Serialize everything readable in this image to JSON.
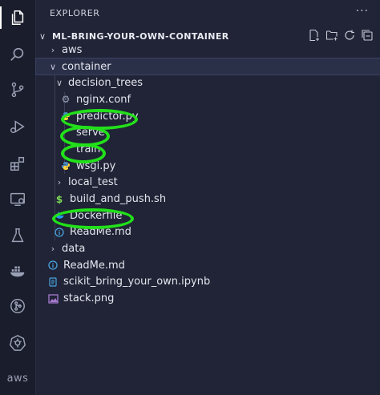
{
  "sidebar": {
    "header": "EXPLORER",
    "more": "···",
    "root_title": "ML-BRING-YOUR-OWN-CONTAINER"
  },
  "tree": [
    {
      "label": "aws",
      "kind": "folder",
      "expanded": false,
      "depth": 0
    },
    {
      "label": "container",
      "kind": "folder",
      "expanded": true,
      "depth": 0,
      "selected": true
    },
    {
      "label": "decision_trees",
      "kind": "folder",
      "expanded": true,
      "depth": 1
    },
    {
      "label": "nginx.conf",
      "kind": "gear",
      "depth": 2
    },
    {
      "label": "predictor.py",
      "kind": "python",
      "depth": 2,
      "highlighted": true
    },
    {
      "label": "serve",
      "kind": "none",
      "depth": 2,
      "highlighted": true
    },
    {
      "label": "train",
      "kind": "none",
      "depth": 2,
      "highlighted": true
    },
    {
      "label": "wsgi.py",
      "kind": "python",
      "depth": 2
    },
    {
      "label": "local_test",
      "kind": "folder",
      "expanded": false,
      "depth": 1
    },
    {
      "label": "build_and_push.sh",
      "kind": "shell",
      "depth": 1
    },
    {
      "label": "Dockerfile",
      "kind": "docker",
      "depth": 1,
      "highlighted": true
    },
    {
      "label": "ReadMe.md",
      "kind": "info",
      "depth": 1
    },
    {
      "label": "data",
      "kind": "folder",
      "expanded": false,
      "depth": 0
    },
    {
      "label": "ReadMe.md",
      "kind": "info",
      "depth": 0
    },
    {
      "label": "scikit_bring_your_own.ipynb",
      "kind": "notebook",
      "depth": 0
    },
    {
      "label": "stack.png",
      "kind": "image",
      "depth": 0
    }
  ],
  "activity": {
    "aws_label": "aws"
  },
  "colors": {
    "highlight": "#22e01a",
    "python": "#4b8bbe",
    "shell": "#7ed957",
    "docker": "#2496ed",
    "info": "#4aa3df",
    "image": "#a97bd1"
  }
}
